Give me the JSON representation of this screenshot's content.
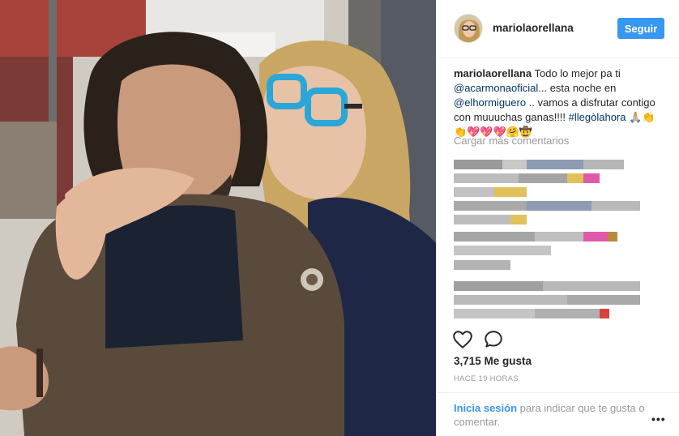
{
  "post": {
    "username": "mariolaorellana",
    "follow_label": "Seguir",
    "caption": {
      "author": "mariolaorellana",
      "part1": " Todo lo mejor pa ti ",
      "mention1": "@acarmonaoficial",
      "part2": "... esta noche en ",
      "mention2": "@elhormiguero",
      "part3": " .. vamos a disfrutar contigo con muuuchas ganas!!!! ",
      "hashtag": "#llegòlahora",
      "emojis": " 🙏🏼👏 👏💖💖💖🤗🤠"
    },
    "load_more": "Cargar más comentarios",
    "likes": "3,715 Me gusta",
    "timestamp": "HACE 19 HORAS",
    "login_link": "Inicia sesión",
    "login_rest": " para indicar que te gusta o comentar.",
    "more": "•••"
  },
  "icons": {
    "like": "heart-icon",
    "comment": "comment-bubble-icon",
    "more": "more-options-icon"
  },
  "colors": {
    "primary_button": "#3897f0",
    "link_dark": "#003569",
    "muted_text": "#999999",
    "text": "#262626"
  }
}
